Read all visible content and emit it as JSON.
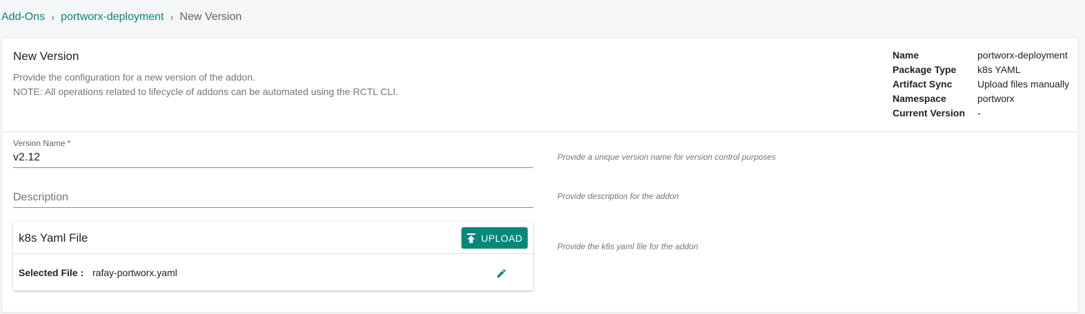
{
  "breadcrumb": {
    "items": [
      "Add-Ons",
      "portworx-deployment"
    ],
    "current": "New Version",
    "separator": "›"
  },
  "header": {
    "title": "New Version",
    "subtitle1": "Provide the configuration for a new version of the addon.",
    "subtitle2": "NOTE: All operations related to lifecycle of addons can be automated using the RCTL CLI."
  },
  "meta": {
    "name_label": "Name",
    "name_value": "portworx-deployment",
    "package_label": "Package Type",
    "package_value": "k8s YAML",
    "sync_label": "Artifact Sync",
    "sync_value": "Upload files manually",
    "namespace_label": "Namespace",
    "namespace_value": "portworx",
    "current_label": "Current Version",
    "current_value": "-"
  },
  "form": {
    "version_label": "Version Name *",
    "version_value": "v2.12",
    "version_hint": "Provide a unique version name for version control purposes",
    "description_placeholder": "Description",
    "description_hint": "Provide description for the addon",
    "file_title": "k8s Yaml File",
    "upload_label": "UPLOAD",
    "file_hint": "Provide the k8s yaml file for the addon",
    "selected_label": "Selected File :",
    "selected_value": "rafay-portworx.yaml"
  },
  "icons": {
    "upload": "upload-icon",
    "edit": "pencil-icon"
  },
  "colors": {
    "accent": "#00897b"
  }
}
